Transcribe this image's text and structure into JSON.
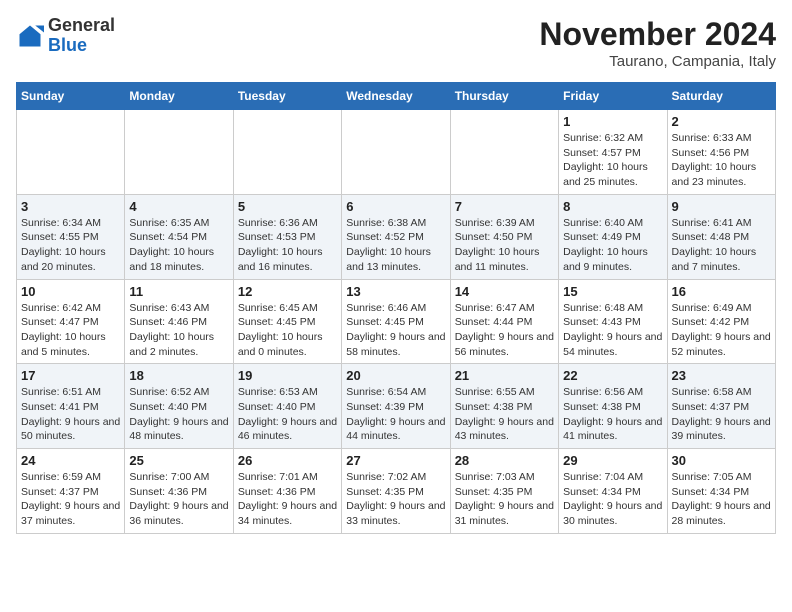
{
  "header": {
    "logo": {
      "general": "General",
      "blue": "Blue"
    },
    "title": "November 2024",
    "subtitle": "Taurano, Campania, Italy"
  },
  "calendar": {
    "weekdays": [
      "Sunday",
      "Monday",
      "Tuesday",
      "Wednesday",
      "Thursday",
      "Friday",
      "Saturday"
    ],
    "weeks": [
      [
        {
          "day": "",
          "info": ""
        },
        {
          "day": "",
          "info": ""
        },
        {
          "day": "",
          "info": ""
        },
        {
          "day": "",
          "info": ""
        },
        {
          "day": "",
          "info": ""
        },
        {
          "day": "1",
          "info": "Sunrise: 6:32 AM\nSunset: 4:57 PM\nDaylight: 10 hours and 25 minutes."
        },
        {
          "day": "2",
          "info": "Sunrise: 6:33 AM\nSunset: 4:56 PM\nDaylight: 10 hours and 23 minutes."
        }
      ],
      [
        {
          "day": "3",
          "info": "Sunrise: 6:34 AM\nSunset: 4:55 PM\nDaylight: 10 hours and 20 minutes."
        },
        {
          "day": "4",
          "info": "Sunrise: 6:35 AM\nSunset: 4:54 PM\nDaylight: 10 hours and 18 minutes."
        },
        {
          "day": "5",
          "info": "Sunrise: 6:36 AM\nSunset: 4:53 PM\nDaylight: 10 hours and 16 minutes."
        },
        {
          "day": "6",
          "info": "Sunrise: 6:38 AM\nSunset: 4:52 PM\nDaylight: 10 hours and 13 minutes."
        },
        {
          "day": "7",
          "info": "Sunrise: 6:39 AM\nSunset: 4:50 PM\nDaylight: 10 hours and 11 minutes."
        },
        {
          "day": "8",
          "info": "Sunrise: 6:40 AM\nSunset: 4:49 PM\nDaylight: 10 hours and 9 minutes."
        },
        {
          "day": "9",
          "info": "Sunrise: 6:41 AM\nSunset: 4:48 PM\nDaylight: 10 hours and 7 minutes."
        }
      ],
      [
        {
          "day": "10",
          "info": "Sunrise: 6:42 AM\nSunset: 4:47 PM\nDaylight: 10 hours and 5 minutes."
        },
        {
          "day": "11",
          "info": "Sunrise: 6:43 AM\nSunset: 4:46 PM\nDaylight: 10 hours and 2 minutes."
        },
        {
          "day": "12",
          "info": "Sunrise: 6:45 AM\nSunset: 4:45 PM\nDaylight: 10 hours and 0 minutes."
        },
        {
          "day": "13",
          "info": "Sunrise: 6:46 AM\nSunset: 4:45 PM\nDaylight: 9 hours and 58 minutes."
        },
        {
          "day": "14",
          "info": "Sunrise: 6:47 AM\nSunset: 4:44 PM\nDaylight: 9 hours and 56 minutes."
        },
        {
          "day": "15",
          "info": "Sunrise: 6:48 AM\nSunset: 4:43 PM\nDaylight: 9 hours and 54 minutes."
        },
        {
          "day": "16",
          "info": "Sunrise: 6:49 AM\nSunset: 4:42 PM\nDaylight: 9 hours and 52 minutes."
        }
      ],
      [
        {
          "day": "17",
          "info": "Sunrise: 6:51 AM\nSunset: 4:41 PM\nDaylight: 9 hours and 50 minutes."
        },
        {
          "day": "18",
          "info": "Sunrise: 6:52 AM\nSunset: 4:40 PM\nDaylight: 9 hours and 48 minutes."
        },
        {
          "day": "19",
          "info": "Sunrise: 6:53 AM\nSunset: 4:40 PM\nDaylight: 9 hours and 46 minutes."
        },
        {
          "day": "20",
          "info": "Sunrise: 6:54 AM\nSunset: 4:39 PM\nDaylight: 9 hours and 44 minutes."
        },
        {
          "day": "21",
          "info": "Sunrise: 6:55 AM\nSunset: 4:38 PM\nDaylight: 9 hours and 43 minutes."
        },
        {
          "day": "22",
          "info": "Sunrise: 6:56 AM\nSunset: 4:38 PM\nDaylight: 9 hours and 41 minutes."
        },
        {
          "day": "23",
          "info": "Sunrise: 6:58 AM\nSunset: 4:37 PM\nDaylight: 9 hours and 39 minutes."
        }
      ],
      [
        {
          "day": "24",
          "info": "Sunrise: 6:59 AM\nSunset: 4:37 PM\nDaylight: 9 hours and 37 minutes."
        },
        {
          "day": "25",
          "info": "Sunrise: 7:00 AM\nSunset: 4:36 PM\nDaylight: 9 hours and 36 minutes."
        },
        {
          "day": "26",
          "info": "Sunrise: 7:01 AM\nSunset: 4:36 PM\nDaylight: 9 hours and 34 minutes."
        },
        {
          "day": "27",
          "info": "Sunrise: 7:02 AM\nSunset: 4:35 PM\nDaylight: 9 hours and 33 minutes."
        },
        {
          "day": "28",
          "info": "Sunrise: 7:03 AM\nSunset: 4:35 PM\nDaylight: 9 hours and 31 minutes."
        },
        {
          "day": "29",
          "info": "Sunrise: 7:04 AM\nSunset: 4:34 PM\nDaylight: 9 hours and 30 minutes."
        },
        {
          "day": "30",
          "info": "Sunrise: 7:05 AM\nSunset: 4:34 PM\nDaylight: 9 hours and 28 minutes."
        }
      ]
    ]
  }
}
